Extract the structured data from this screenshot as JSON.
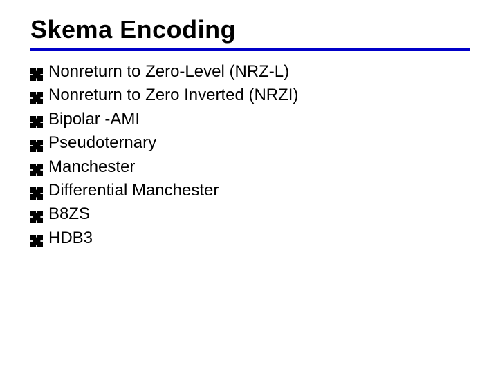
{
  "slide": {
    "title": "Skema Encoding",
    "rule_color": "#0000c8",
    "bullets": [
      "Nonreturn to Zero-Level (NRZ-L)",
      "Nonreturn to Zero Inverted (NRZI)",
      "Bipolar -AMI",
      "Pseudoternary",
      "Manchester",
      "Differential Manchester",
      "B8ZS",
      "HDB3"
    ]
  }
}
